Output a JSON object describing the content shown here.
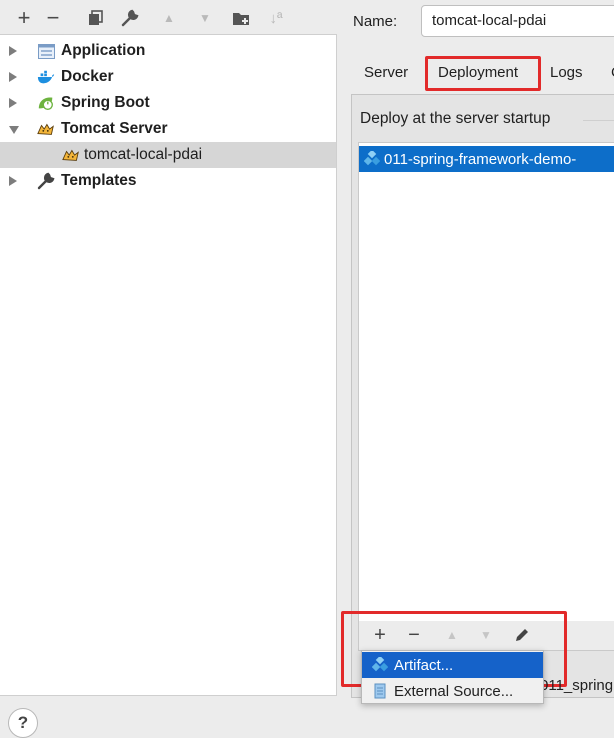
{
  "toolbar": {
    "items": [
      {
        "name": "add",
        "glyph": "+"
      },
      {
        "name": "remove",
        "glyph": "−"
      },
      {
        "name": "copy",
        "glyph": "❐"
      },
      {
        "name": "edit",
        "glyph": "✎"
      },
      {
        "name": "move-up",
        "glyph": "▲"
      },
      {
        "name": "move-down",
        "glyph": "▼"
      },
      {
        "name": "new-folder",
        "glyph": "📁"
      },
      {
        "name": "sort",
        "glyph": "↓ª"
      }
    ]
  },
  "tree": {
    "items": [
      {
        "label": "Application",
        "icon": "application-icon",
        "expanded": false
      },
      {
        "label": "Docker",
        "icon": "docker-icon",
        "expanded": false
      },
      {
        "label": "Spring Boot",
        "icon": "spring-boot-icon",
        "expanded": false
      },
      {
        "label": "Tomcat Server",
        "icon": "tomcat-icon",
        "expanded": true
      },
      {
        "label": "tomcat-local-pdai",
        "icon": "tomcat-icon",
        "child": true,
        "selected": true
      },
      {
        "label": "Templates",
        "icon": "wrench-icon",
        "expanded": false
      }
    ]
  },
  "config": {
    "name_label": "Name:",
    "name_value": "tomcat-local-pdai",
    "tabs": [
      "Server",
      "Deployment",
      "Logs",
      "C"
    ],
    "active_tab": "Deployment",
    "deploy_label": "Deploy at the server startup",
    "deploy_items": [
      "011-spring-framework-demo-"
    ],
    "list_toolbar": {
      "add": "+",
      "remove": "−",
      "up": "▲",
      "down": "▼",
      "edit": "✎"
    },
    "behind_text": "011_spring"
  },
  "popup": {
    "items": [
      {
        "label": "Artifact...",
        "icon": "artifact-icon",
        "highlighted": true
      },
      {
        "label": "External Source...",
        "icon": "external-source-icon",
        "highlighted": false
      }
    ]
  },
  "help": {
    "glyph": "?"
  },
  "colors": {
    "selection": "#0d6ec9",
    "highlight_box": "#e22a2a",
    "menu_highlight": "#1562c9"
  }
}
